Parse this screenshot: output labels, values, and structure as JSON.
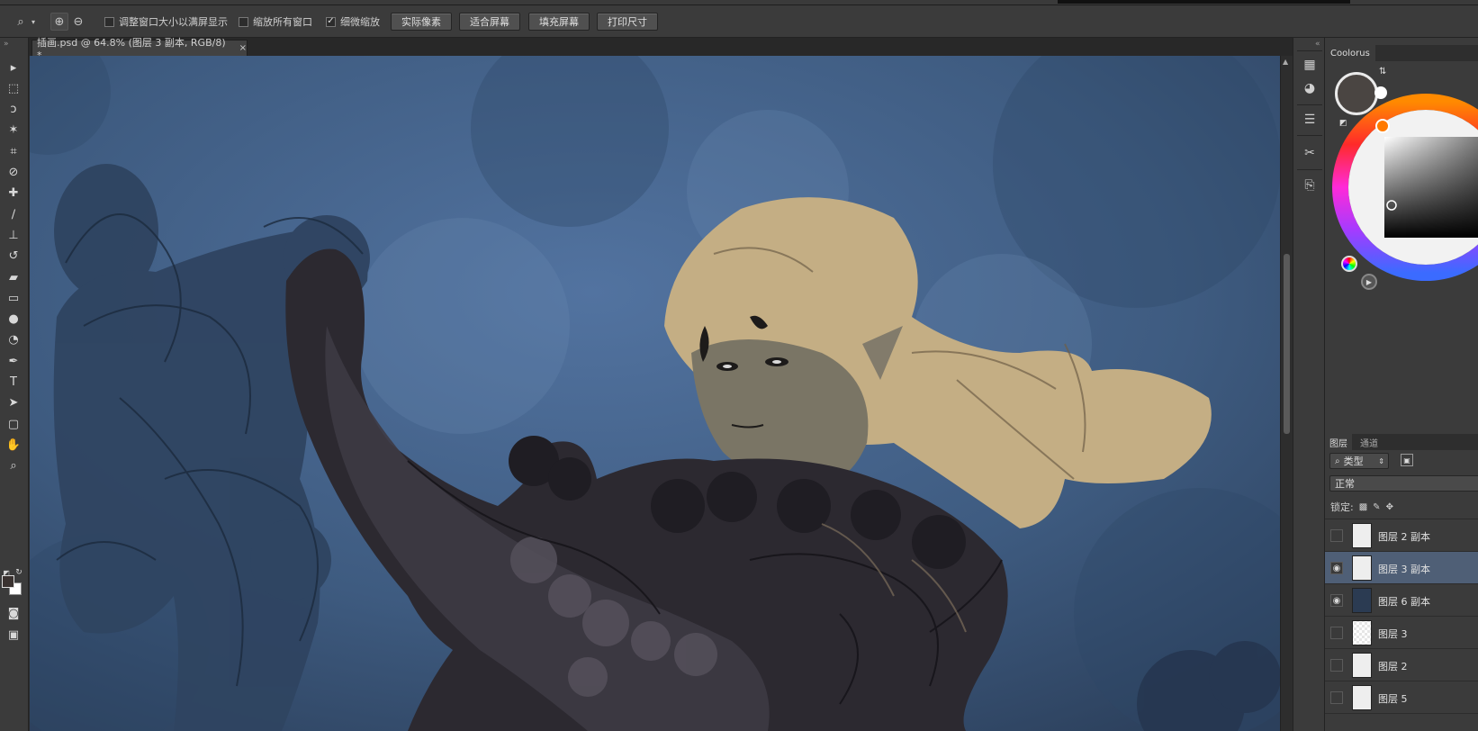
{
  "options_bar": {
    "checkbox_resize_windows": "调整窗口大小以满屏显示",
    "checkbox_zoom_all": "缩放所有窗口",
    "checkbox_scrubby_zoom": "细微缩放",
    "btn_actual_pixels": "实际像素",
    "btn_fit_screen": "适合屏幕",
    "btn_fill_screen": "填充屏幕",
    "btn_print_size": "打印尺寸",
    "scrubby_zoom_checked": true
  },
  "document": {
    "tab_title": "插画.psd @ 64.8% (图层 3 副本, RGB/8) *",
    "close_glyph": "×"
  },
  "tools": [
    {
      "name": "move-tool",
      "glyph": "▸"
    },
    {
      "name": "marquee-tool",
      "glyph": "⬚"
    },
    {
      "name": "lasso-tool",
      "glyph": "ↄ"
    },
    {
      "name": "magic-wand-tool",
      "glyph": "✶"
    },
    {
      "name": "crop-tool",
      "glyph": "⌗"
    },
    {
      "name": "eyedropper-tool",
      "glyph": "⊘"
    },
    {
      "name": "healing-brush-tool",
      "glyph": "✚"
    },
    {
      "name": "brush-tool",
      "glyph": "∕"
    },
    {
      "name": "clone-stamp-tool",
      "glyph": "⊥"
    },
    {
      "name": "history-brush-tool",
      "glyph": "↺"
    },
    {
      "name": "eraser-tool",
      "glyph": "▰"
    },
    {
      "name": "gradient-tool",
      "glyph": "▭"
    },
    {
      "name": "blur-tool",
      "glyph": "●"
    },
    {
      "name": "dodge-tool",
      "glyph": "◔"
    },
    {
      "name": "pen-tool",
      "glyph": "✒"
    },
    {
      "name": "type-tool",
      "glyph": "T"
    },
    {
      "name": "path-selection-tool",
      "glyph": "➤"
    },
    {
      "name": "shape-tool",
      "glyph": "▢"
    },
    {
      "name": "hand-tool",
      "glyph": "✋"
    },
    {
      "name": "zoom-tool",
      "glyph": "⌕"
    }
  ],
  "colorus": {
    "tab_label": "Coolorus",
    "current_color": "#4a4542"
  },
  "layers_panel": {
    "tab_layers": "图层",
    "tab_channels": "通道",
    "filter_label": "类型",
    "blend_mode": "正常",
    "lock_label": "锁定:",
    "layers": [
      {
        "name": "图层 2 副本",
        "visible": false,
        "active": false,
        "thumb": "sketch"
      },
      {
        "name": "图层 3 副本",
        "visible": true,
        "active": true,
        "thumb": "sketch"
      },
      {
        "name": "图层 6 副本",
        "visible": true,
        "active": false,
        "thumb": "dark"
      },
      {
        "name": "图层 3",
        "visible": false,
        "active": false,
        "thumb": "checker"
      },
      {
        "name": "图层 2",
        "visible": false,
        "active": false,
        "thumb": "sketch"
      },
      {
        "name": "图层 5",
        "visible": false,
        "active": false,
        "thumb": "sketch"
      }
    ]
  }
}
